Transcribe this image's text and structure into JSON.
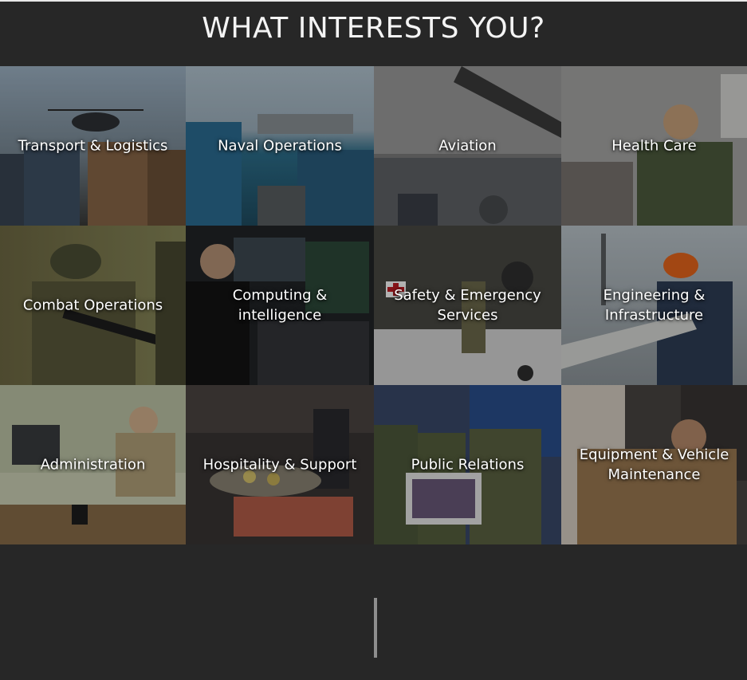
{
  "section": {
    "title": "WHAT INTERESTS YOU?"
  },
  "tiles": [
    {
      "label": "Transport & Logistics",
      "scene": "helicopter-deck-crew-photo"
    },
    {
      "label": "Naval Operations",
      "scene": "ship-sailors-photo"
    },
    {
      "label": "Aviation",
      "scene": "jet-cockpit-photo"
    },
    {
      "label": "Health Care",
      "scene": "medic-phone-photo"
    },
    {
      "label": "Combat Operations",
      "scene": "soldier-rifle-photo"
    },
    {
      "label": "Computing & intelligence",
      "scene": "operator-screens-photo"
    },
    {
      "label": "Safety & Emergency Services",
      "scene": "rescue-helicopter-photo"
    },
    {
      "label": "Engineering & Infrastructure",
      "scene": "engineer-hardhat-photo"
    },
    {
      "label": "Administration",
      "scene": "office-desk-photo"
    },
    {
      "label": "Hospitality & Support",
      "scene": "kitchen-food-photo"
    },
    {
      "label": "Public Relations",
      "scene": "masked-personnel-photo"
    },
    {
      "label": "Equipment & Vehicle Maintenance",
      "scene": "mechanic-engine-photo"
    }
  ],
  "colors": {
    "background": "#272727",
    "heading_text": "#f4f4f4",
    "tile_label": "#ffffff",
    "scroll_indicator": "#8e8e8e"
  }
}
